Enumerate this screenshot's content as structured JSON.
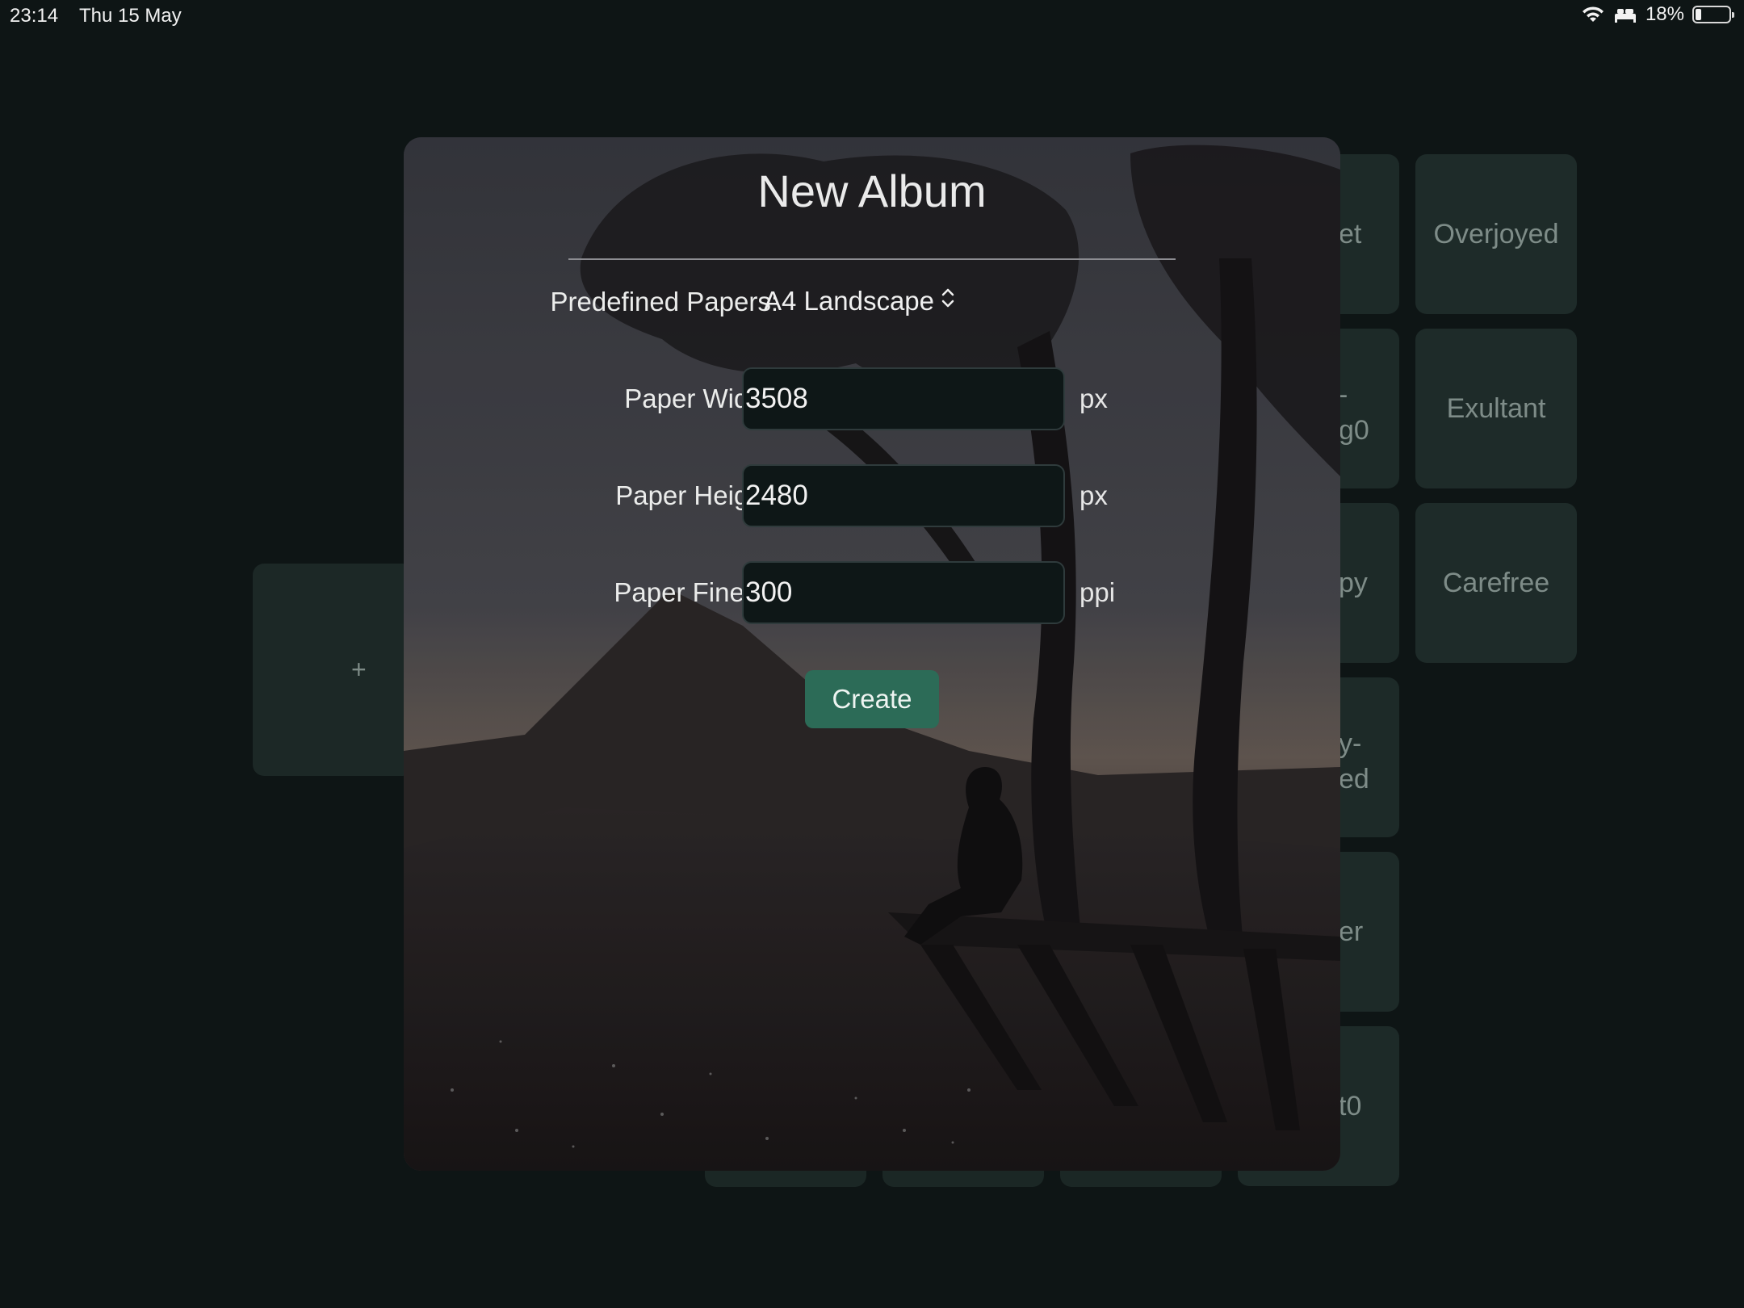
{
  "status_bar": {
    "time": "23:14",
    "date": "Thu 15 May",
    "battery_percent_label": "18%",
    "battery_level": 0.18
  },
  "background_tiles": {
    "right_column": [
      "Overjoyed",
      "Exultant",
      "Carefree"
    ],
    "partial_column": [
      "et",
      "-\ng0",
      "py",
      "y-\ned",
      "er",
      "t0"
    ],
    "add_symbol": "+"
  },
  "dialog": {
    "title": "New Album",
    "predefined_label": "Predefined Papers:",
    "predefined_value": "A4 Landscape",
    "fields": [
      {
        "label": "Paper Width:",
        "value": "3508",
        "unit": "px"
      },
      {
        "label": "Paper Height:",
        "value": "2480",
        "unit": "px"
      },
      {
        "label": "Paper Finess:",
        "value": "300",
        "unit": "ppi"
      }
    ],
    "create_label": "Create"
  },
  "colors": {
    "accent": "#2c6b57",
    "background": "#0e1515",
    "tile": "#1e2b29"
  }
}
